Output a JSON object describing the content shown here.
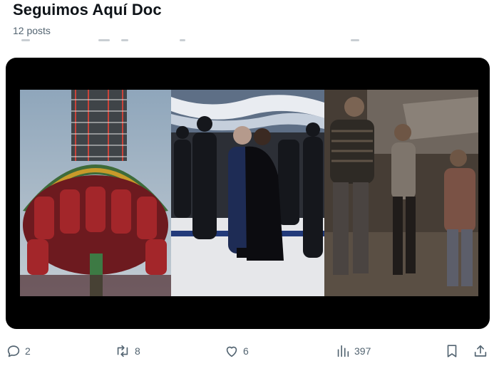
{
  "header": {
    "title": "Seguimos Aquí Doc",
    "post_count": "12 posts"
  },
  "media": {
    "type": "video",
    "panels": [
      "drop-tower-ride",
      "dance-hall-couple-embracing",
      "people-dancing-dim-room"
    ]
  },
  "actions": {
    "reply_count": "2",
    "repost_count": "8",
    "like_count": "6",
    "views_count": "397"
  },
  "colors": {
    "text_primary": "#0f1419",
    "text_secondary": "#536471",
    "media_bg": "#000000"
  },
  "icons": [
    "reply-icon",
    "repost-icon",
    "like-icon",
    "views-icon",
    "bookmark-icon",
    "share-icon"
  ]
}
